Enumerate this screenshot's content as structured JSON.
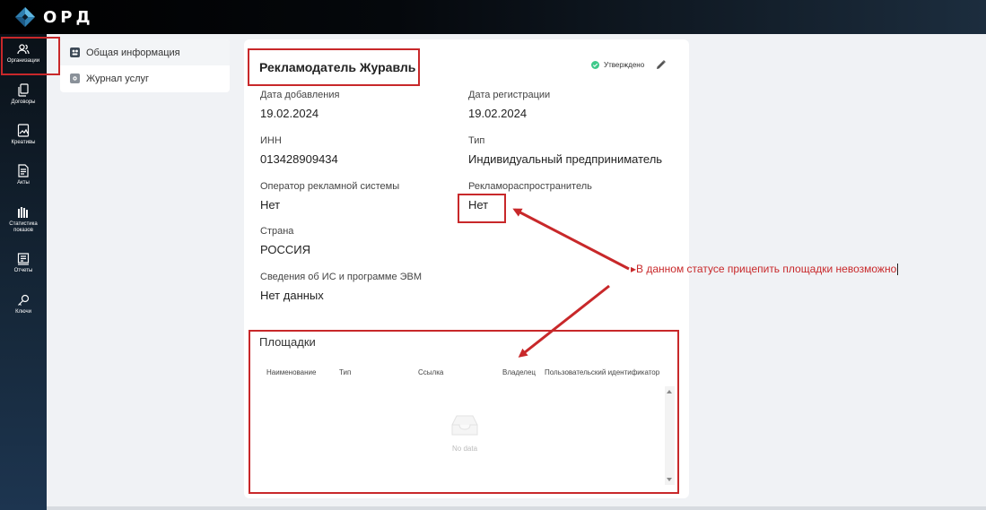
{
  "app": {
    "logo_text": "ОРД"
  },
  "sidebar": {
    "items": [
      {
        "label": "Организации",
        "icon": "users-icon"
      },
      {
        "label": "Договоры",
        "icon": "documents-icon"
      },
      {
        "label": "Креативы",
        "icon": "image-icon"
      },
      {
        "label": "Акты",
        "icon": "file-icon"
      },
      {
        "label": "Статистика показов",
        "icon": "stats-icon"
      },
      {
        "label": "Отчеты",
        "icon": "report-icon"
      },
      {
        "label": "Ключи",
        "icon": "key-icon"
      }
    ]
  },
  "submenu": {
    "items": [
      {
        "label": "Общая информация",
        "icon": "info-icon"
      },
      {
        "label": "Журнал услуг",
        "icon": "settings-icon"
      }
    ]
  },
  "card": {
    "title": "Рекламодатель Журавль",
    "status": "Утверждено",
    "status_color": "#3ec98a",
    "fields": {
      "added_label": "Дата добавления",
      "added_value": "19.02.2024",
      "registered_label": "Дата регистрации",
      "registered_value": "19.02.2024",
      "inn_label": "ИНН",
      "inn_value": "013428909434",
      "type_label": "Тип",
      "type_value": "Индивидуальный предприниматель",
      "operator_label": "Оператор рекламной системы",
      "operator_value": "Нет",
      "distributor_label": "Рекламораспространитель",
      "distributor_value": "Нет",
      "country_label": "Страна",
      "country_value": "РОССИЯ",
      "is_label": "Сведения об ИС и программе ЭВМ",
      "is_value": "Нет данных"
    }
  },
  "platforms": {
    "title": "Площадки",
    "columns": [
      "Наименование",
      "Тип",
      "Ссылка",
      "Владелец",
      "Пользовательский идентификатор"
    ],
    "empty_text": "No data"
  },
  "annotation": {
    "text": "▸В данном статусе прицепить площадки невозможно",
    "color": "#c8282a"
  }
}
